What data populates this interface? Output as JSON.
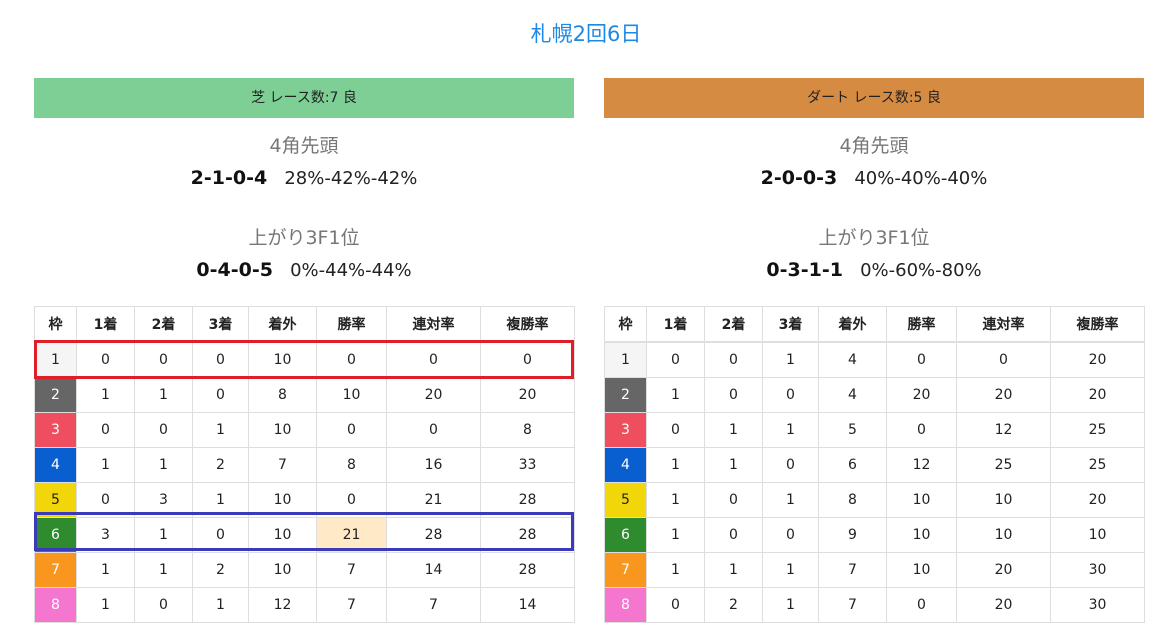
{
  "page": {
    "title": "札幌2回6日"
  },
  "columns": [
    "枠",
    "1着",
    "2着",
    "3着",
    "着外",
    "勝率",
    "連対率",
    "複勝率"
  ],
  "waku_colors": [
    "#f5f5f5",
    "#666666",
    "#ef4e5e",
    "#0a5fd0",
    "#f1d60a",
    "#2e8b2e",
    "#f9961d",
    "#f576cf"
  ],
  "waku_text_colors": [
    "#222222",
    "#ffffff",
    "#ffffff",
    "#ffffff",
    "#222222",
    "#ffffff",
    "#ffffff",
    "#ffffff"
  ],
  "highlight_cell_color": "#ffe9c7",
  "turf": {
    "header": "芝 レース数:7 良",
    "header_color": "#7dcf96",
    "corner_label": "4角先頭",
    "corner_record": [
      "2",
      "1",
      "0",
      "4"
    ],
    "corner_pct": "28%-42%-42%",
    "last3f_label": "上がり3F1位",
    "last3f_record": [
      "0",
      "4",
      "0",
      "5"
    ],
    "last3f_pct": "0%-44%-44%",
    "rows": [
      [
        "1",
        "0",
        "0",
        "0",
        "10",
        "0",
        "0",
        "0"
      ],
      [
        "2",
        "1",
        "1",
        "0",
        "8",
        "10",
        "20",
        "20"
      ],
      [
        "3",
        "0",
        "0",
        "1",
        "10",
        "0",
        "0",
        "8"
      ],
      [
        "4",
        "1",
        "1",
        "2",
        "7",
        "8",
        "16",
        "33"
      ],
      [
        "5",
        "0",
        "3",
        "1",
        "10",
        "0",
        "21",
        "28"
      ],
      [
        "6",
        "3",
        "1",
        "0",
        "10",
        "21",
        "28",
        "28"
      ],
      [
        "7",
        "1",
        "1",
        "2",
        "10",
        "7",
        "14",
        "28"
      ],
      [
        "8",
        "1",
        "0",
        "1",
        "12",
        "7",
        "7",
        "14"
      ]
    ]
  },
  "dirt": {
    "header": "ダート レース数:5 良",
    "header_color": "#d68b42",
    "corner_label": "4角先頭",
    "corner_record": [
      "2",
      "0",
      "0",
      "3"
    ],
    "corner_pct": "40%-40%-40%",
    "last3f_label": "上がり3F1位",
    "last3f_record": [
      "0",
      "3",
      "1",
      "1"
    ],
    "last3f_pct": "0%-60%-80%",
    "rows": [
      [
        "1",
        "0",
        "0",
        "1",
        "4",
        "0",
        "0",
        "20"
      ],
      [
        "2",
        "1",
        "0",
        "0",
        "4",
        "20",
        "20",
        "20"
      ],
      [
        "3",
        "0",
        "1",
        "1",
        "5",
        "0",
        "12",
        "25"
      ],
      [
        "4",
        "1",
        "1",
        "0",
        "6",
        "12",
        "25",
        "25"
      ],
      [
        "5",
        "1",
        "0",
        "1",
        "8",
        "10",
        "10",
        "20"
      ],
      [
        "6",
        "1",
        "0",
        "0",
        "9",
        "10",
        "10",
        "10"
      ],
      [
        "7",
        "1",
        "1",
        "1",
        "7",
        "10",
        "20",
        "30"
      ],
      [
        "8",
        "0",
        "2",
        "1",
        "7",
        "0",
        "20",
        "30"
      ]
    ]
  }
}
